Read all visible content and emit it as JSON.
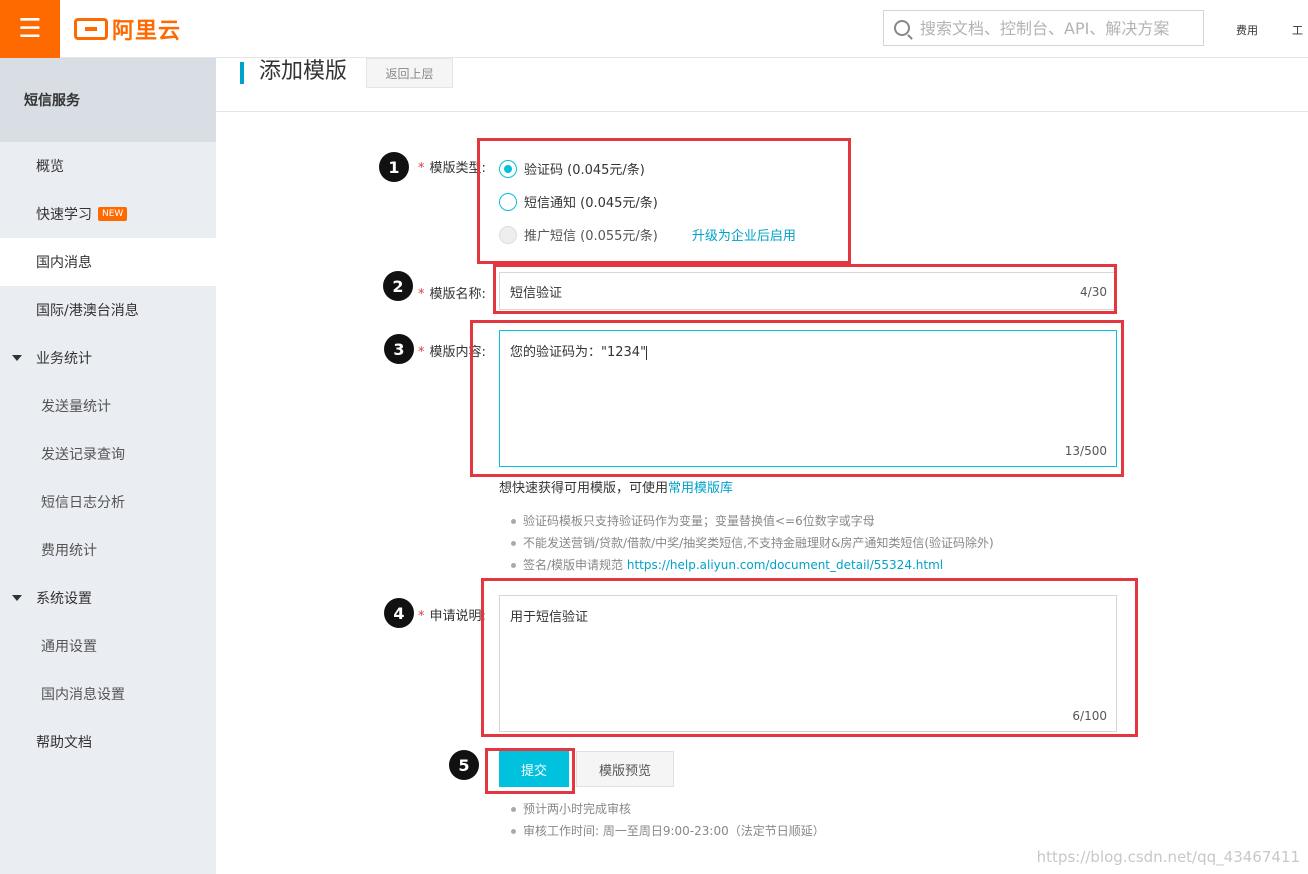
{
  "topbar": {
    "menu_icon": "hamburger-menu-icon",
    "logo_text": "阿里云",
    "search_placeholder": "搜索文档、控制台、API、解决方案",
    "link_fee": "费用",
    "link_work": "工"
  },
  "sidebar": {
    "header": "短信服务",
    "items": [
      {
        "label": "概览"
      },
      {
        "label": "快速学习",
        "badge": "NEW"
      },
      {
        "label": "国内消息"
      },
      {
        "label": "国际/港澳台消息"
      },
      {
        "label": "业务统计"
      },
      {
        "label": "发送量统计"
      },
      {
        "label": "发送记录查询"
      },
      {
        "label": "短信日志分析"
      },
      {
        "label": "费用统计"
      },
      {
        "label": "系统设置"
      },
      {
        "label": "通用设置"
      },
      {
        "label": "国内消息设置"
      },
      {
        "label": "帮助文档"
      }
    ]
  },
  "header": {
    "title": "添加模版",
    "back_label": "返回上层"
  },
  "form": {
    "type_label": "模版类型:",
    "type_options": [
      {
        "label": "验证码 (0.045元/条)",
        "checked": true
      },
      {
        "label": "短信通知 (0.045元/条)",
        "checked": false
      },
      {
        "label": "推广短信 (0.055元/条)",
        "disabled": true
      }
    ],
    "upgrade_link": "升级为企业后启用",
    "name_label": "模版名称:",
    "name_value": "短信验证",
    "name_counter": "4/30",
    "content_label": "模版内容:",
    "content_value": "您的验证码为：\"1234\"",
    "content_counter": "13/500",
    "quick_hint_prefix": "想快速获得可用模版，可使用",
    "quick_hint_link": "常用模版库",
    "notes": [
      "验证码模板只支持验证码作为变量；变量替换值<=6位数字或字母",
      "不能发送营销/贷款/借款/中奖/抽奖类短信,不支持金融理财&房产通知类短信(验证码除外)"
    ],
    "spec_prefix": "签名/模版申请规范",
    "spec_link": "https://help.aliyun.com/document_detail/55324.html",
    "desc_label": "申请说明:",
    "desc_value": "用于短信验证",
    "desc_counter": "6/100",
    "required_mark": "*",
    "submit_label": "提交",
    "preview_label": "模版预览",
    "footer_notes": [
      "预计两小时完成审核",
      "审核工作时间: 周一至周日9:00-23:00（法定节日顺延）"
    ]
  },
  "annotations": [
    "1",
    "2",
    "3",
    "4",
    "5"
  ],
  "watermark": "https://blog.csdn.net/qq_43467411",
  "colors": {
    "accent": "#00c1de",
    "brand": "#ff6a00",
    "annotation": "#e3363f"
  }
}
